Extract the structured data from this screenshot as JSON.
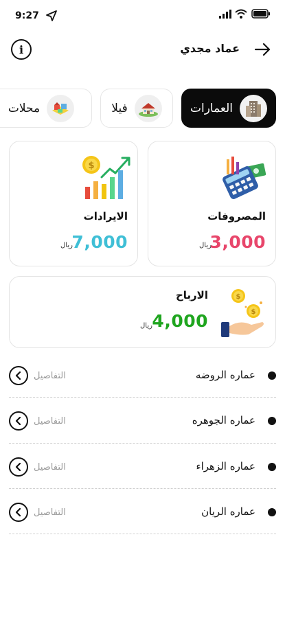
{
  "status_bar": {
    "time": "9:27"
  },
  "header": {
    "title": "عماد مجدي"
  },
  "tabs": [
    {
      "label": "العمارات",
      "icon": "building-icon",
      "active": true
    },
    {
      "label": "فيلا",
      "icon": "villa-icon",
      "active": false
    },
    {
      "label": "محلات",
      "icon": "shops-icon",
      "active": false
    }
  ],
  "cards": {
    "expenses": {
      "title": "المصروفات",
      "amount": "3,000",
      "currency": "ريال",
      "color": "#e8466b"
    },
    "revenues": {
      "title": "الايرادات",
      "amount": "7,000",
      "currency": "ريال",
      "color": "#3fbfd6"
    },
    "profits": {
      "title": "الارباح",
      "amount": "4,000",
      "currency": "ريال",
      "color": "#1fa51f"
    }
  },
  "list": {
    "details_label": "التفاصيل",
    "items": [
      {
        "name": "عماره الروضه"
      },
      {
        "name": "عماره الجوهره"
      },
      {
        "name": "عماره الزهراء"
      },
      {
        "name": "عماره الريان"
      }
    ]
  }
}
